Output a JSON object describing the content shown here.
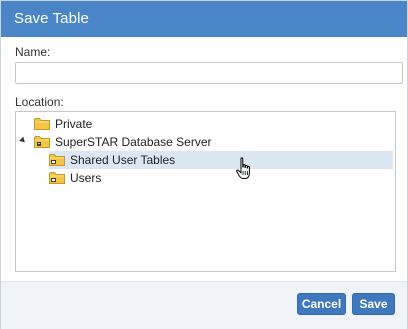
{
  "dialog": {
    "title": "Save Table"
  },
  "form": {
    "name_label": "Name:",
    "name_value": "",
    "location_label": "Location:"
  },
  "tree": {
    "items": [
      {
        "label": "Private",
        "icon": "folder-icon",
        "level": 0,
        "expanded": null,
        "selected": false
      },
      {
        "label": "SuperSTAR Database Server",
        "icon": "server-folder-icon",
        "level": 0,
        "expanded": true,
        "selected": false
      },
      {
        "label": "Shared User Tables",
        "icon": "shared-folder-icon",
        "level": 1,
        "expanded": null,
        "selected": true
      },
      {
        "label": "Users",
        "icon": "shared-folder-icon",
        "level": 1,
        "expanded": null,
        "selected": false
      }
    ]
  },
  "buttons": {
    "cancel_label": "Cancel",
    "save_label": "Save"
  },
  "colors": {
    "titlebar": "#4a86c7",
    "button": "#3f78bc",
    "selection": "#dde7f3",
    "folder": "#f4c743"
  }
}
